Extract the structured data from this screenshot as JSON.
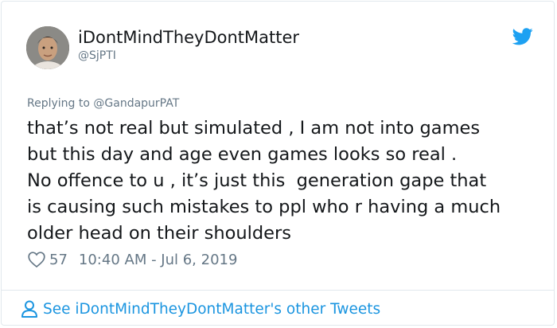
{
  "author": {
    "display_name": "iDontMindTheyDontMatter",
    "handle": "@SjPTI"
  },
  "reply": {
    "prefix": "Replying to ",
    "mention": "@GandapurPAT"
  },
  "tweet": {
    "lines": [
      "that’s not real but simulated , I am not into games",
      "but this day and age even games looks so real .",
      "No offence to u , it’s just this  generation gape that",
      "is causing such mistakes to ppl who r having a much",
      "older head on their shoulders"
    ]
  },
  "meta": {
    "likes": "57",
    "timestamp": "10:40 AM - Jul 6, 2019"
  },
  "footer": {
    "link_text": "See iDontMindTheyDontMatter's other Tweets"
  },
  "colors": {
    "twitter_blue": "#1b95e0",
    "secondary_text": "#657786",
    "primary_text": "#14171a"
  },
  "icons": {
    "brand": "twitter-bird-icon",
    "like": "heart-icon",
    "profile": "person-icon"
  }
}
